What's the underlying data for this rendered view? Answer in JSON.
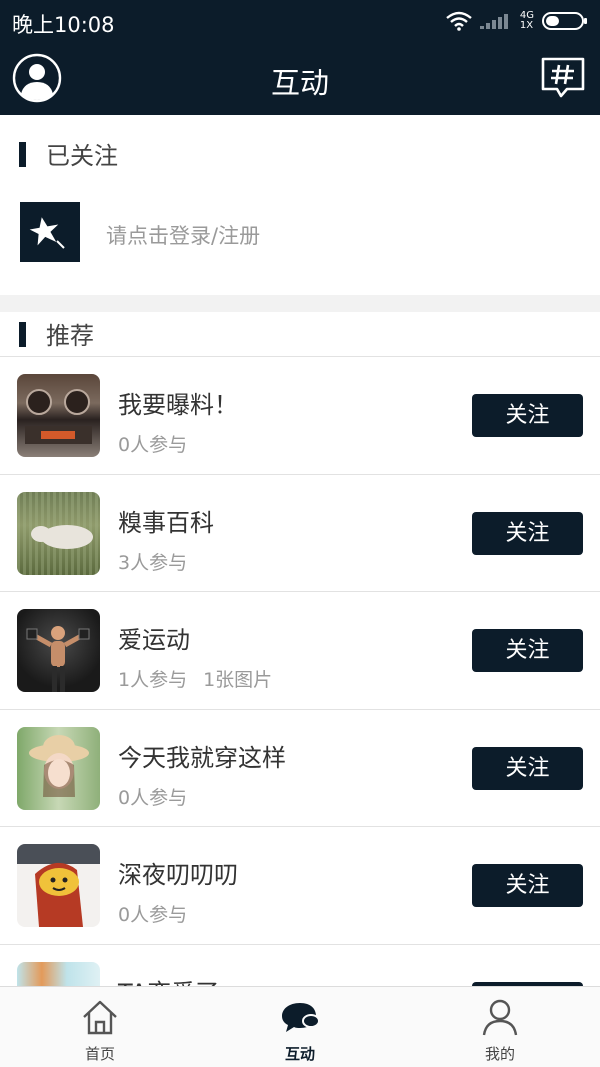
{
  "status_bar": {
    "time": "晚上10:08",
    "network": "4G",
    "sim": "1X",
    "icons": [
      "wifi-icon",
      "signal-icon",
      "battery-icon"
    ]
  },
  "header": {
    "title": "互动",
    "left_icon": "user-avatar-icon",
    "right_icon": "hashtag-topic-icon"
  },
  "followed": {
    "heading": "已关注",
    "login_prompt": "请点击登录/注册",
    "icon": "star-icon"
  },
  "recommend": {
    "heading": "推荐",
    "follow_label": "关注",
    "items": [
      {
        "title": "我要曝料！",
        "participants": "0人参与",
        "images": ""
      },
      {
        "title": "糗事百科",
        "participants": "3人参与",
        "images": ""
      },
      {
        "title": "爱运动",
        "participants": "1人参与",
        "images": "1张图片"
      },
      {
        "title": "今天我就穿这样",
        "participants": "0人参与",
        "images": ""
      },
      {
        "title": "深夜叨叨叨",
        "participants": "0人参与",
        "images": ""
      },
      {
        "title": "TA恋爱了",
        "participants": "",
        "images": ""
      }
    ]
  },
  "bottom_nav": {
    "items": [
      {
        "label": "首页",
        "icon": "home-icon",
        "active": false
      },
      {
        "label": "互动",
        "icon": "chat-bubbles-icon",
        "active": true
      },
      {
        "label": "我的",
        "icon": "person-icon",
        "active": false
      }
    ]
  },
  "colors": {
    "primary": "#0c1c2a",
    "background": "#ffffff",
    "divider": "#f2f2f2",
    "secondary_text": "#9a9a9a"
  }
}
